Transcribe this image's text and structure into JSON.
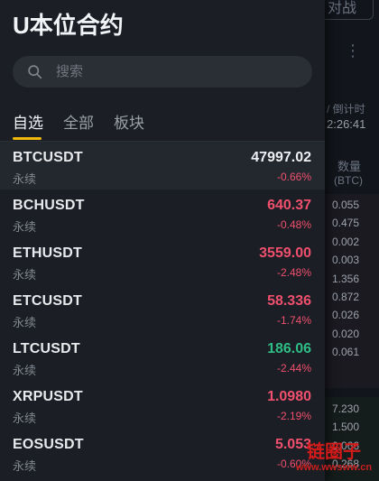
{
  "drawer": {
    "title": "U本位合约",
    "search": {
      "placeholder": "搜索"
    },
    "tabs": [
      {
        "label": "自选",
        "active": true
      },
      {
        "label": "全部",
        "active": false
      },
      {
        "label": "板块",
        "active": false
      }
    ],
    "markets": [
      {
        "symbol": "BTCUSDT",
        "type": "永续",
        "price": "47997.02",
        "change": "-0.66%",
        "price_color": "white"
      },
      {
        "symbol": "BCHUSDT",
        "type": "永续",
        "price": "640.37",
        "change": "-0.48%",
        "price_color": "red"
      },
      {
        "symbol": "ETHUSDT",
        "type": "永续",
        "price": "3559.00",
        "change": "-2.48%",
        "price_color": "red"
      },
      {
        "symbol": "ETCUSDT",
        "type": "永续",
        "price": "58.336",
        "change": "-1.74%",
        "price_color": "red"
      },
      {
        "symbol": "LTCUSDT",
        "type": "永续",
        "price": "186.06",
        "change": "-2.44%",
        "price_color": "green"
      },
      {
        "symbol": "XRPUSDT",
        "type": "永续",
        "price": "1.0980",
        "change": "-2.19%",
        "price_color": "red"
      },
      {
        "symbol": "EOSUSDT",
        "type": "永续",
        "price": "5.053",
        "change": "-0.60%",
        "price_color": "red"
      }
    ]
  },
  "background": {
    "top_button": "对战",
    "countdown_label": "/ 倒计时",
    "countdown": "2:26:41",
    "qty_label": "数量",
    "qty_unit": "(BTC)",
    "ask_qty": [
      "0.055",
      "0.475",
      "0.002",
      "0.003",
      "1.356",
      "0.872",
      "0.026",
      "0.020",
      "0.061"
    ],
    "bid_qty": [
      "7.230",
      "1.500",
      "0.066",
      "0.268"
    ]
  },
  "watermark": {
    "main": "链圈子",
    "url": "www.wwsww.cn"
  },
  "colors": {
    "accent": "#f0b90b",
    "down": "#f0506e",
    "up": "#2ebd85",
    "panel": "#1b1e24"
  }
}
